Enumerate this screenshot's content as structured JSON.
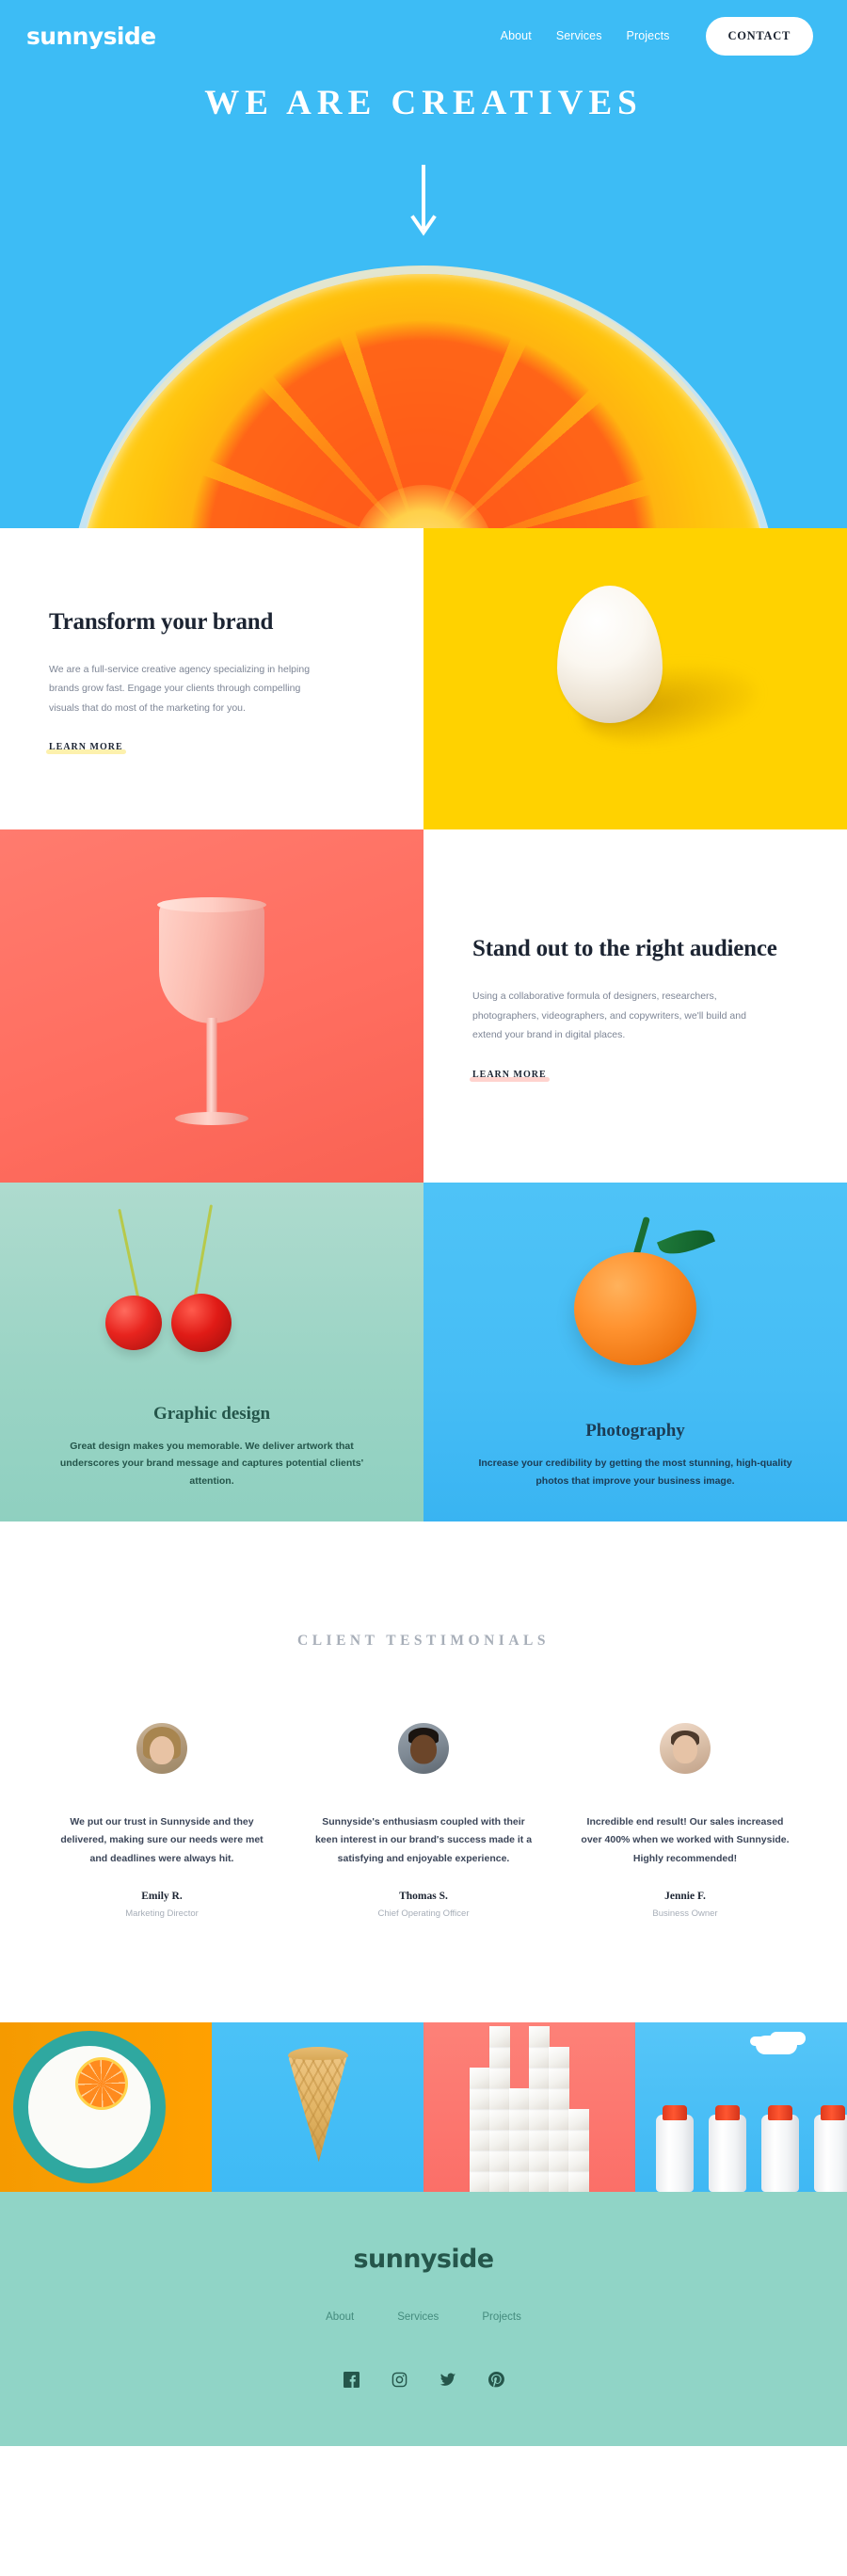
{
  "brand": {
    "name": "sunnyside"
  },
  "colors": {
    "hero_blue": "#3DBCF5",
    "yellow": "#FFD200",
    "coral": "#FF6E60",
    "mint": "#90D4C6",
    "dark_green": "#25564B",
    "navy": "#1C2432"
  },
  "header": {
    "logo": "sunnyside",
    "nav": [
      {
        "label": "About"
      },
      {
        "label": "Services"
      },
      {
        "label": "Projects"
      }
    ],
    "cta_label": "CONTACT"
  },
  "hero": {
    "title": "WE ARE CREATIVES",
    "scroll_icon": "down-arrow-icon"
  },
  "features": [
    {
      "title": "Transform your brand",
      "body": "We are a full-service creative agency specializing in helping brands grow fast. Engage your clients through compelling visuals that do most of the marketing for you.",
      "cta": "LEARN MORE",
      "underline": "yellow",
      "image_alt": "egg-image"
    },
    {
      "title": "Stand out to the right audience",
      "body": "Using a collaborative formula of designers, researchers, photographers, videographers, and copywriters, we'll build and extend your brand in digital places.",
      "cta": "LEARN MORE",
      "underline": "red",
      "image_alt": "pink-glass-cup-image"
    }
  ],
  "services": [
    {
      "title": "Graphic design",
      "body": "Great design makes you memorable. We deliver artwork that underscores your brand message and captures potential clients' attention.",
      "image_alt": "cherries-image"
    },
    {
      "title": "Photography",
      "body": "Increase your credibility by getting the most stunning, high-quality photos that improve your business image.",
      "image_alt": "tangerine-image"
    }
  ],
  "testimonials": {
    "heading": "CLIENT TESTIMONIALS",
    "items": [
      {
        "quote": "We put our trust in Sunnyside and they delivered, making sure our needs were met and deadlines were always hit.",
        "name": "Emily R.",
        "role": "Marketing Director",
        "avatar_alt": "avatar-emily"
      },
      {
        "quote": "Sunnyside's enthusiasm coupled with their keen interest in our brand's success made it a satisfying and enjoyable experience.",
        "name": "Thomas S.",
        "role": "Chief Operating Officer",
        "avatar_alt": "avatar-thomas"
      },
      {
        "quote": "Incredible end result! Our sales increased over 400% when we worked with Sunnyside. Highly recommended!",
        "name": "Jennie F.",
        "role": "Business Owner",
        "avatar_alt": "avatar-jennie"
      }
    ]
  },
  "gallery": [
    {
      "alt": "milk-bottles-image-orange-plate"
    },
    {
      "alt": "ice-cream-cone-image"
    },
    {
      "alt": "sugar-cubes-image"
    },
    {
      "alt": "milk-bottles-image"
    }
  ],
  "footer": {
    "logo": "sunnyside",
    "nav": [
      {
        "label": "About"
      },
      {
        "label": "Services"
      },
      {
        "label": "Projects"
      }
    ],
    "social": [
      {
        "name": "facebook-icon"
      },
      {
        "name": "instagram-icon"
      },
      {
        "name": "twitter-icon"
      },
      {
        "name": "pinterest-icon"
      }
    ]
  }
}
